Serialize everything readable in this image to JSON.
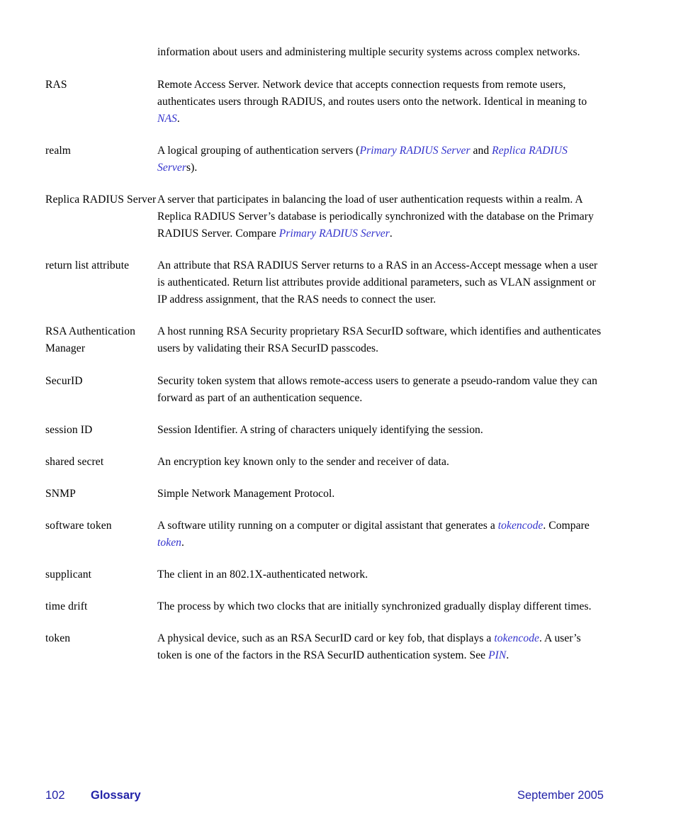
{
  "page": {
    "background": "#ffffff",
    "text_color": "#000000",
    "link_color": "#3333cc",
    "footer_color": "#2222a8"
  },
  "continuation": {
    "text": "information about users and administering multiple security systems across complex networks."
  },
  "entries": [
    {
      "term": "RAS",
      "def_part1": "Remote Access Server. Network device that accepts connection requests from remote users, authenticates users through RADIUS, and routes users onto the network. Identical in meaning to ",
      "link1": "NAS",
      "def_part2": ".",
      "link2": "",
      "def_part3": "",
      "link3": "",
      "def_part4": ""
    },
    {
      "term": "realm",
      "def_part1": "A logical grouping of authentication servers (",
      "link1": "Primary RADIUS Server",
      "def_part2": " and ",
      "link2": "Replica RADIUS Server",
      "def_part3": "s).",
      "link3": "",
      "def_part4": ""
    },
    {
      "term": "Replica RADIUS Server",
      "def_part1": "A server that participates in balancing the load of user authentication requests within a realm. A Replica RADIUS Server’s database is periodically synchronized with the database on the Primary RADIUS Server. Compare ",
      "link1": "Primary RADIUS Server",
      "def_part2": ".",
      "link2": "",
      "def_part3": "",
      "link3": "",
      "def_part4": ""
    },
    {
      "term": "return list attribute",
      "def_part1": "An attribute that RSA RADIUS Server returns to a RAS in an Access-Accept message when a user is authenticated. Return list attributes provide additional parameters, such as VLAN assignment or IP address assignment, that the RAS needs to connect the user.",
      "link1": "",
      "def_part2": "",
      "link2": "",
      "def_part3": "",
      "link3": "",
      "def_part4": ""
    },
    {
      "term": "RSA Authentication Manager",
      "def_part1": "A host running RSA Security proprietary RSA SecurID software, which identifies and authenticates users by validating their RSA SecurID passcodes.",
      "link1": "",
      "def_part2": "",
      "link2": "",
      "def_part3": "",
      "link3": "",
      "def_part4": ""
    },
    {
      "term": "SecurID",
      "def_part1": "Security token system that allows remote-access users to generate a pseudo-random value they can forward as part of an authentication sequence.",
      "link1": "",
      "def_part2": "",
      "link2": "",
      "def_part3": "",
      "link3": "",
      "def_part4": ""
    },
    {
      "term": "session ID",
      "def_part1": "Session Identifier. A string of characters uniquely identifying the session.",
      "link1": "",
      "def_part2": "",
      "link2": "",
      "def_part3": "",
      "link3": "",
      "def_part4": ""
    },
    {
      "term": "shared secret",
      "def_part1": "An encryption key known only to the sender and receiver of data.",
      "link1": "",
      "def_part2": "",
      "link2": "",
      "def_part3": "",
      "link3": "",
      "def_part4": ""
    },
    {
      "term": "SNMP",
      "def_part1": "Simple Network Management Protocol.",
      "link1": "",
      "def_part2": "",
      "link2": "",
      "def_part3": "",
      "link3": "",
      "def_part4": ""
    },
    {
      "term": "software token",
      "def_part1": "A software utility running on a computer or digital assistant that generates a ",
      "link1": "tokencode",
      "def_part2": ". Compare ",
      "link2": "token",
      "def_part3": ".",
      "link3": "",
      "def_part4": ""
    },
    {
      "term": "supplicant",
      "def_part1": "The client in an 802.1X-authenticated network.",
      "link1": "",
      "def_part2": "",
      "link2": "",
      "def_part3": "",
      "link3": "",
      "def_part4": ""
    },
    {
      "term": "time drift",
      "def_part1": "The process by which two clocks that are initially synchronized gradually display different times.",
      "link1": "",
      "def_part2": "",
      "link2": "",
      "def_part3": "",
      "link3": "",
      "def_part4": ""
    },
    {
      "term": "token",
      "def_part1": "A physical device, such as an RSA SecurID card or key fob, that displays a ",
      "link1": "tokencode",
      "def_part2": ". A user’s token is one of the factors in the RSA SecurID authentication system. See ",
      "link2": "PIN",
      "def_part3": ".",
      "link3": "",
      "def_part4": ""
    }
  ],
  "footer": {
    "page_number": "102",
    "section": "Glossary",
    "date": "September 2005"
  }
}
